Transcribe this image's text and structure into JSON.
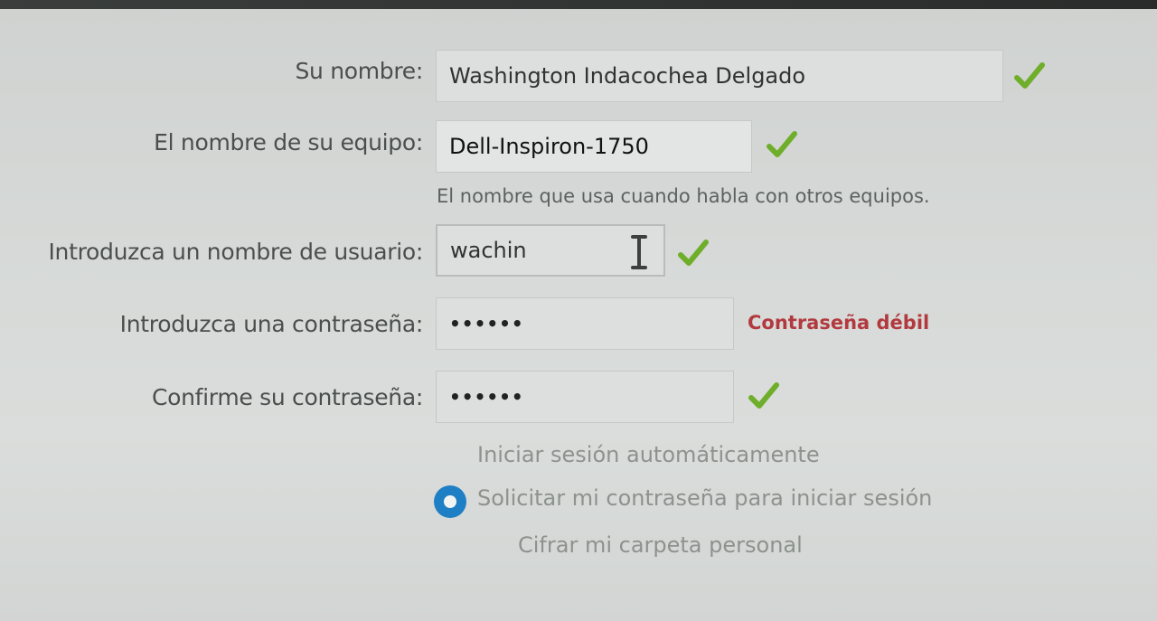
{
  "form": {
    "name_label": "Su nombre:",
    "name_value": "Washington Indacochea Delgado",
    "computer_label": "El nombre de su equipo:",
    "computer_value": "Dell-Inspiron-1750",
    "computer_hint": "El nombre que usa cuando habla con otros equipos.",
    "username_label": "Introduzca un nombre de usuario:",
    "username_value": "wachin",
    "password_label": "Introduzca una contraseña:",
    "password_value": "••••••",
    "password_strength": "Contraseña débil",
    "confirm_label": "Confirme su contraseña:",
    "confirm_value": "••••••"
  },
  "options": {
    "auto_login": "Iniciar sesión automáticamente",
    "require_password": "Solicitar mi contraseña para iniciar sesión",
    "encrypt_home": "Cifrar mi carpeta personal"
  },
  "colors": {
    "check_green": "#6fae2a",
    "weak_red": "#b23a3f",
    "radio_blue": "#1f7fc4"
  },
  "icons": {
    "valid": "check-icon",
    "cursor": "text-cursor-icon"
  }
}
